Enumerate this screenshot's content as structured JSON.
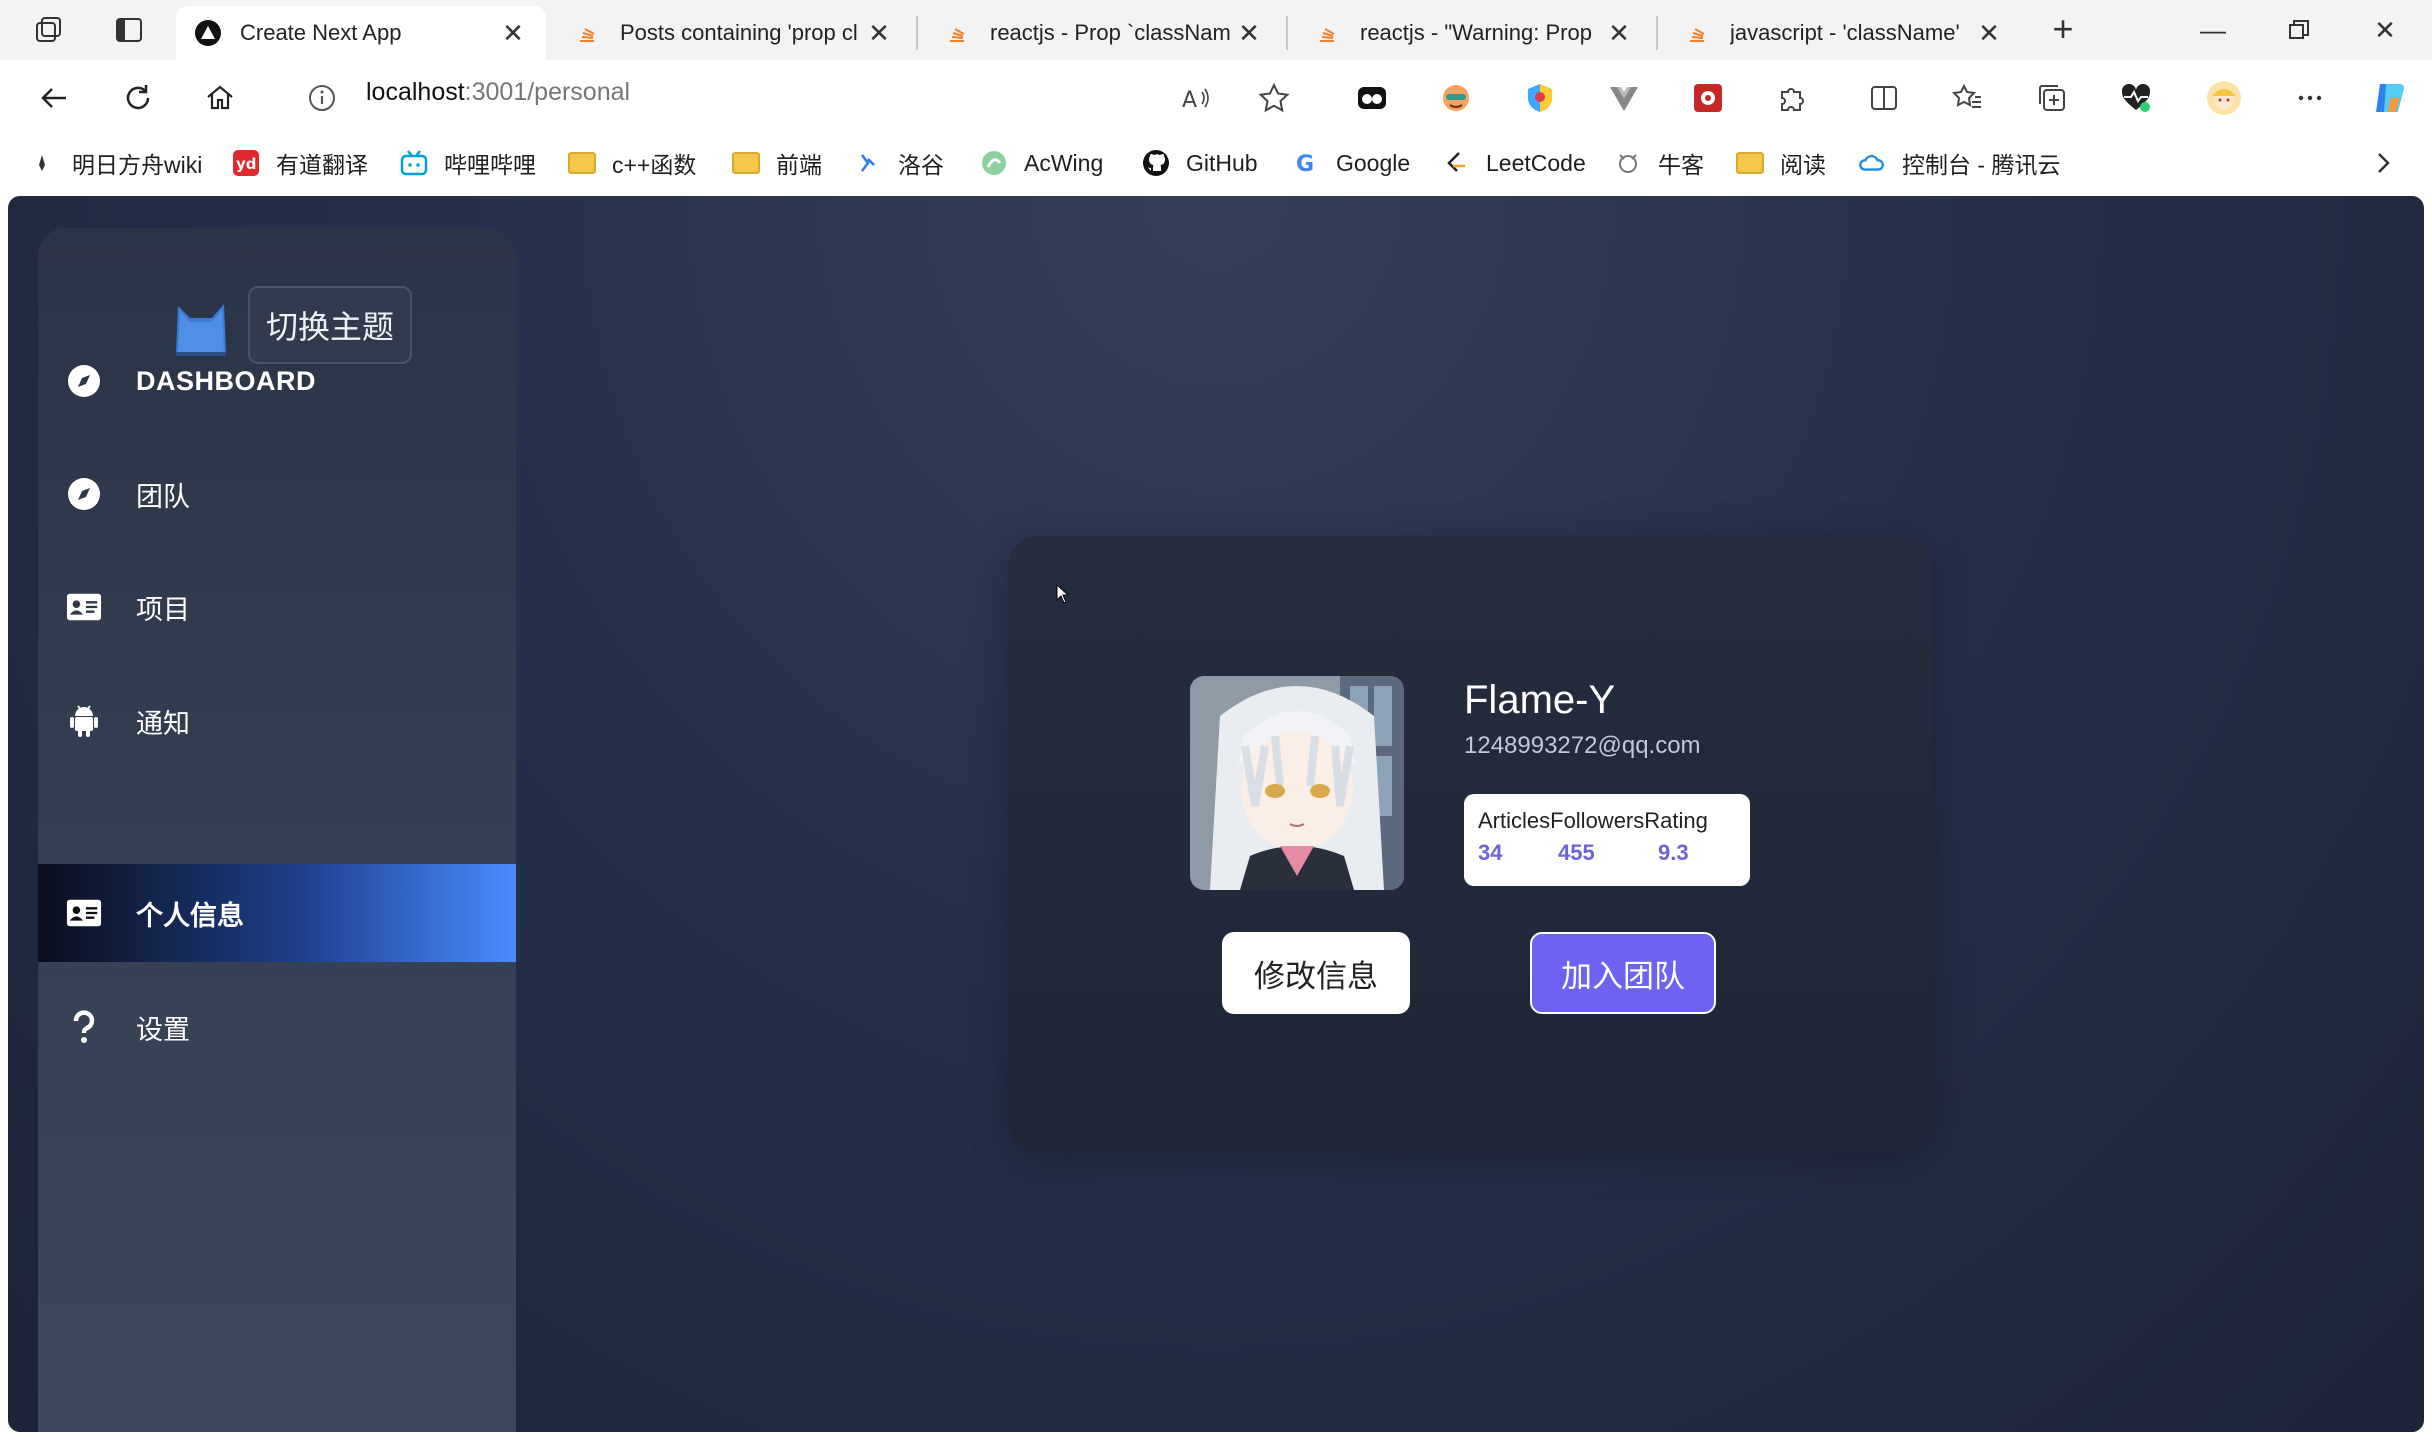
{
  "browser": {
    "tabs": [
      {
        "title": "Create Next App",
        "active": true
      },
      {
        "title": "Posts containing 'prop cl",
        "active": false
      },
      {
        "title": "reactjs - Prop `classNam",
        "active": false
      },
      {
        "title": "reactjs - \"Warning: Prop",
        "active": false
      },
      {
        "title": "javascript - 'className' ",
        "active": false
      }
    ],
    "url_host": "localhost",
    "url_path": ":3001/personal",
    "bookmarks": [
      {
        "label": "明日方舟wiki",
        "icon": "arknights-icon"
      },
      {
        "label": "有道翻译",
        "icon": "youdao-icon"
      },
      {
        "label": "哔哩哔哩",
        "icon": "bilibili-icon"
      },
      {
        "label": "c++函数",
        "icon": "folder-icon"
      },
      {
        "label": "前端",
        "icon": "folder-icon"
      },
      {
        "label": "洛谷",
        "icon": "luogu-icon"
      },
      {
        "label": "AcWing",
        "icon": "acwing-icon"
      },
      {
        "label": "GitHub",
        "icon": "github-icon"
      },
      {
        "label": "Google",
        "icon": "google-icon"
      },
      {
        "label": "LeetCode",
        "icon": "leetcode-icon"
      },
      {
        "label": "牛客",
        "icon": "nowcoder-icon"
      },
      {
        "label": "阅读",
        "icon": "folder-icon"
      },
      {
        "label": "控制台 - 腾讯云",
        "icon": "tencent-cloud-icon"
      }
    ]
  },
  "sidebar": {
    "theme_button": "切换主题",
    "items": [
      {
        "label": "DASHBOARD",
        "icon": "compass-icon",
        "active": false
      },
      {
        "label": "团队",
        "icon": "compass-icon",
        "active": false
      },
      {
        "label": "项目",
        "icon": "id-card-icon",
        "active": false
      },
      {
        "label": "通知",
        "icon": "android-icon",
        "active": false
      },
      {
        "label": "个人信息",
        "icon": "id-card-icon",
        "active": true
      },
      {
        "label": "设置",
        "icon": "question-icon",
        "active": false
      }
    ]
  },
  "profile": {
    "name": "Flame-Y",
    "email": "1248993272@qq.com",
    "stats": {
      "headers": [
        "Articles",
        "Followers",
        "Rating"
      ],
      "values": [
        "34",
        "455",
        "9.3"
      ]
    },
    "edit_button": "修改信息",
    "join_button": "加入团队"
  },
  "colors": {
    "accent": "#6e62f2",
    "stat_value": "#6c63d9",
    "active_menu_end": "#4a8cff"
  }
}
